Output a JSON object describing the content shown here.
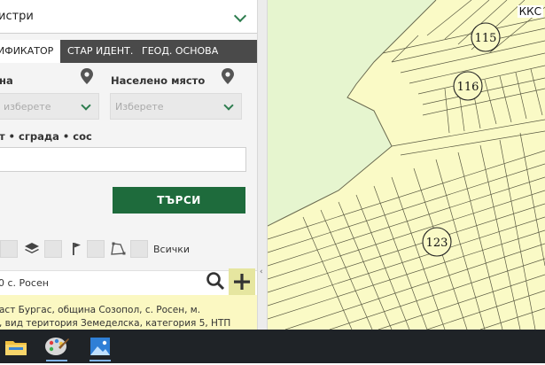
{
  "panel": {
    "registry_select": "истри",
    "tabs": [
      {
        "label": "ИФИКАТОР",
        "active": true
      },
      {
        "label": "СТАР ИДЕНТ.",
        "active": false
      },
      {
        "label": "ГЕОД. ОСНОВА",
        "active": false
      }
    ],
    "field_left_label": "на",
    "field_left_placeholder": "изберете",
    "field_right_label": "Населено място",
    "field_right_placeholder": "Изберете",
    "object_label": "т • сграда • сос",
    "object_value": "",
    "search_button": "ТЪРСИ",
    "layers_all_label": "Всички",
    "result_query": "0 с. Росен",
    "result_line1": "аст Бургас, община Созопол, с. Росен, м.",
    "result_line2": ", вид територия Земеделска, категория 5, НТП"
  },
  "map": {
    "corner_label": "ККС",
    "parcel_labels": [
      "115",
      "116",
      "123"
    ],
    "colors": {
      "land": "#fafac6",
      "meadow": "#e6f5cf",
      "parcel_line": "#5a5a42"
    }
  },
  "taskbar": {
    "apps": [
      "file-explorer-icon",
      "paint-icon",
      "photos-icon"
    ]
  },
  "colors": {
    "accent_green": "#1e6b3c",
    "tab_bar": "#4a4a4a",
    "result_bg": "#fbf8c2",
    "taskbar": "#1f2327"
  }
}
